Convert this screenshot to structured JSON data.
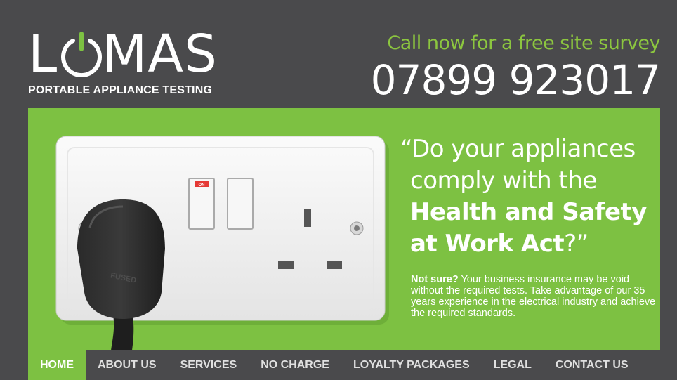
{
  "brand": {
    "name_pre": "L",
    "name_post": "MAS",
    "tagline": "PORTABLE APPLIANCE TESTING",
    "accent_color": "#7dc142"
  },
  "header": {
    "cta_text": "Call now for a free site survey",
    "phone": "07899 923017"
  },
  "hero": {
    "quote_open": "“Do your appliances",
    "quote_line2": "comply with the",
    "quote_bold1": "Health and Safety",
    "quote_bold2": "at Work Act",
    "quote_close": "?”",
    "body_lead": "Not sure?",
    "body_text": " Your business insurance may be void without the required tests. Take advantage of our 35 years experience in the electrical industry and achieve the required standards.",
    "switch_label": "ON",
    "plug_label": "FUSED"
  },
  "nav": {
    "items": [
      {
        "label": "HOME",
        "active": true
      },
      {
        "label": "ABOUT US"
      },
      {
        "label": "SERVICES"
      },
      {
        "label": "NO CHARGE"
      },
      {
        "label": "LOYALTY PACKAGES"
      },
      {
        "label": "LEGAL"
      },
      {
        "label": "CONTACT US"
      }
    ]
  }
}
